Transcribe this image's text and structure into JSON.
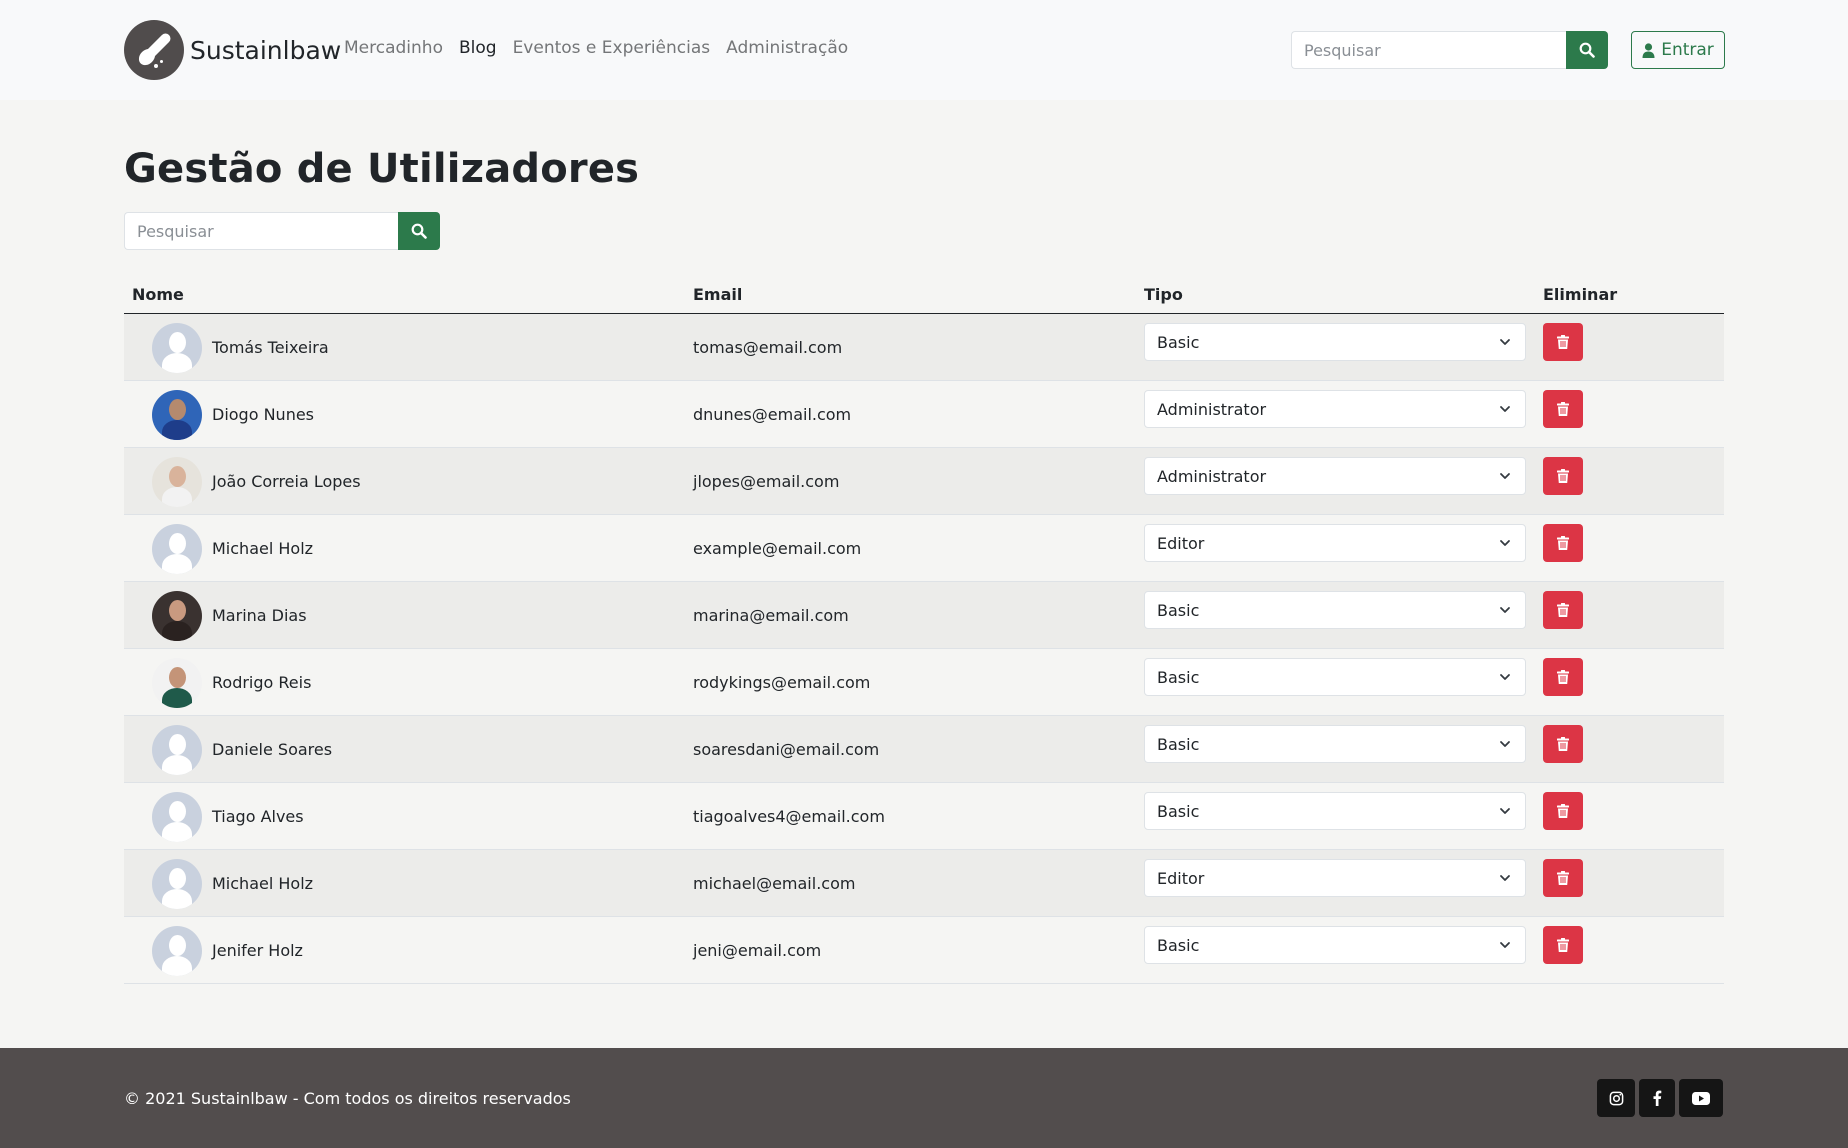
{
  "navbar": {
    "brand": "Sustainlbaw",
    "links": [
      {
        "label": "Mercadinho",
        "active": false
      },
      {
        "label": "Blog",
        "active": true
      },
      {
        "label": "Eventos e Experiências",
        "active": false
      },
      {
        "label": "Administração",
        "active": false
      }
    ],
    "search_placeholder": "Pesquisar",
    "login_label": "Entrar"
  },
  "main": {
    "title": "Gestão de Utilizadores",
    "search_placeholder": "Pesquisar",
    "columns": [
      "Nome",
      "Email",
      "Tipo",
      "Eliminar"
    ],
    "users": [
      {
        "name": "Tomás Teixeira",
        "email": "tomas@email.com",
        "type": "Basic",
        "avatar": "placeholder"
      },
      {
        "name": "Diogo Nunes",
        "email": "dnunes@email.com",
        "type": "Administrator",
        "avatar": "photo"
      },
      {
        "name": "João Correia Lopes",
        "email": "jlopes@email.com",
        "type": "Administrator",
        "avatar": "photo"
      },
      {
        "name": "Michael Holz",
        "email": "example@email.com",
        "type": "Editor",
        "avatar": "placeholder"
      },
      {
        "name": "Marina Dias",
        "email": "marina@email.com",
        "type": "Basic",
        "avatar": "photo"
      },
      {
        "name": "Rodrigo Reis",
        "email": "rodykings@email.com",
        "type": "Basic",
        "avatar": "photo"
      },
      {
        "name": "Daniele Soares",
        "email": "soaresdani@email.com",
        "type": "Basic",
        "avatar": "placeholder"
      },
      {
        "name": "Tiago Alves",
        "email": "tiagoalves4@email.com",
        "type": "Basic",
        "avatar": "placeholder"
      },
      {
        "name": "Michael Holz",
        "email": "michael@email.com",
        "type": "Editor",
        "avatar": "placeholder"
      },
      {
        "name": "Jenifer Holz",
        "email": "jeni@email.com",
        "type": "Basic",
        "avatar": "placeholder"
      }
    ]
  },
  "footer": {
    "copyright": "© 2021 Sustainlbaw - Com todos os direitos reservados",
    "socials": [
      "instagram-icon",
      "facebook-icon",
      "youtube-icon"
    ]
  },
  "colors": {
    "accent_green": "#2c7a4b",
    "danger_red": "#dc3545",
    "footer_bg": "#524d4d"
  }
}
